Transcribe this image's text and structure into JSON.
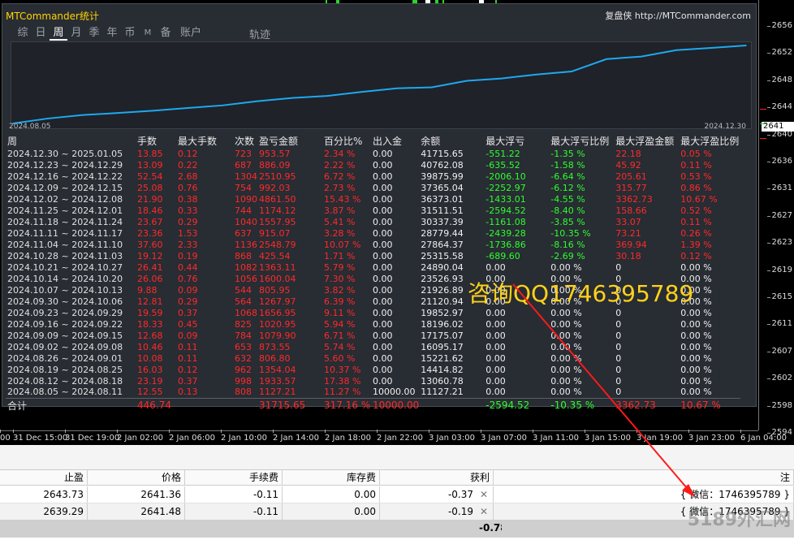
{
  "panel": {
    "title": "MTCommander统计",
    "site": "复盘侠 http://MTCommander.com",
    "tabs": [
      "综",
      "日",
      "周",
      "月",
      "季",
      "年",
      "币",
      "M",
      "备",
      "账户"
    ],
    "active_tab": "周",
    "track_label": "轨迹",
    "date_start": "2024.08.05",
    "date_end": "2024.12.30"
  },
  "table": {
    "headers": [
      "周",
      "手数",
      "最大手数",
      "次数",
      "盈亏金额",
      "百分比%",
      "出入金",
      "余额",
      "最大浮亏",
      "最大浮亏比例",
      "最大浮盈金额",
      "最大浮盈比例"
    ],
    "rows": [
      [
        "2024.12.30 ~ 2025.01.05",
        "13.85",
        "0.12",
        "723",
        "953.57",
        "2.34 %",
        "0.00",
        "41715.65",
        "-551.22",
        "-1.35 %",
        "22.18",
        "0.05 %"
      ],
      [
        "2024.12.23 ~ 2024.12.29",
        "13.09",
        "0.22",
        "687",
        "886.09",
        "2.22 %",
        "0.00",
        "40762.08",
        "-635.52",
        "-1.58 %",
        "45.92",
        "0.11 %"
      ],
      [
        "2024.12.16 ~ 2024.12.22",
        "52.54",
        "2.68",
        "1304",
        "2510.95",
        "6.72 %",
        "0.00",
        "39875.99",
        "-2006.10",
        "-6.64 %",
        "205.61",
        "0.53 %"
      ],
      [
        "2024.12.09 ~ 2024.12.15",
        "25.08",
        "0.76",
        "754",
        "992.03",
        "2.73 %",
        "0.00",
        "37365.04",
        "-2252.97",
        "-6.12 %",
        "315.77",
        "0.86 %"
      ],
      [
        "2024.12.02 ~ 2024.12.08",
        "21.90",
        "0.38",
        "1090",
        "4861.50",
        "15.43 %",
        "0.00",
        "36373.01",
        "-1433.01",
        "-4.55 %",
        "3362.73",
        "10.67 %"
      ],
      [
        "2024.11.25 ~ 2024.12.01",
        "18.46",
        "0.33",
        "744",
        "1174.12",
        "3.87 %",
        "0.00",
        "31511.51",
        "-2594.52",
        "-8.40 %",
        "158.66",
        "0.52 %"
      ],
      [
        "2024.11.18 ~ 2024.11.24",
        "23.67",
        "0.29",
        "1040",
        "1557.95",
        "5.41 %",
        "0.00",
        "30337.39",
        "-1161.08",
        "-3.85 %",
        "33.07",
        "0.11 %"
      ],
      [
        "2024.11.11 ~ 2024.11.17",
        "23.36",
        "1.53",
        "637",
        "915.07",
        "3.28 %",
        "0.00",
        "28779.44",
        "-2439.28",
        "-10.35 %",
        "73.21",
        "0.26 %"
      ],
      [
        "2024.11.04 ~ 2024.11.10",
        "37.60",
        "2.33",
        "1136",
        "2548.79",
        "10.07 %",
        "0.00",
        "27864.37",
        "-1736.86",
        "-8.16 %",
        "369.94",
        "1.39 %"
      ],
      [
        "2024.10.28 ~ 2024.11.03",
        "19.12",
        "0.19",
        "868",
        "425.54",
        "1.71 %",
        "0.00",
        "25315.58",
        "-689.60",
        "-2.69 %",
        "30.18",
        "0.12 %"
      ],
      [
        "2024.10.21 ~ 2024.10.27",
        "26.41",
        "0.44",
        "1082",
        "1363.11",
        "5.79 %",
        "0.00",
        "24890.04",
        "0.00",
        "0.00 %",
        "0",
        "0.00 %"
      ],
      [
        "2024.10.14 ~ 2024.10.20",
        "26.06",
        "0.76",
        "1056",
        "1600.04",
        "7.30 %",
        "0.00",
        "23526.93",
        "0.00",
        "0.00 %",
        "0",
        "0.00 %"
      ],
      [
        "2024.10.07 ~ 2024.10.13",
        "9.88",
        "0.09",
        "544",
        "805.95",
        "3.82 %",
        "0.00",
        "21926.89",
        "0.00",
        "0.00 %",
        "0",
        "0.00 %"
      ],
      [
        "2024.09.30 ~ 2024.10.06",
        "12.81",
        "0.29",
        "564",
        "1267.97",
        "6.39 %",
        "0.00",
        "21120.94",
        "0.00",
        "0.00 %",
        "0",
        "0.00 %"
      ],
      [
        "2024.09.23 ~ 2024.09.29",
        "19.59",
        "0.37",
        "1068",
        "1656.95",
        "9.11 %",
        "0.00",
        "19852.97",
        "0.00",
        "0.00 %",
        "0",
        "0.00 %"
      ],
      [
        "2024.09.16 ~ 2024.09.22",
        "18.33",
        "0.45",
        "825",
        "1020.95",
        "5.94 %",
        "0.00",
        "18196.02",
        "0.00",
        "0.00 %",
        "0",
        "0.00 %"
      ],
      [
        "2024.09.09 ~ 2024.09.15",
        "12.68",
        "0.09",
        "784",
        "1079.90",
        "6.71 %",
        "0.00",
        "17175.07",
        "0.00",
        "0.00 %",
        "0",
        "0.00 %"
      ],
      [
        "2024.09.02 ~ 2024.09.08",
        "10.46",
        "0.11",
        "653",
        "873.55",
        "5.74 %",
        "0.00",
        "16095.17",
        "0.00",
        "0.00 %",
        "0",
        "0.00 %"
      ],
      [
        "2024.08.26 ~ 2024.09.01",
        "10.08",
        "0.11",
        "632",
        "806.80",
        "5.60 %",
        "0.00",
        "15221.62",
        "0.00",
        "0.00 %",
        "0",
        "0.00 %"
      ],
      [
        "2024.08.19 ~ 2024.08.25",
        "16.03",
        "0.12",
        "962",
        "1354.04",
        "10.37 %",
        "0.00",
        "14414.82",
        "0.00",
        "0.00 %",
        "0",
        "0.00 %"
      ],
      [
        "2024.08.12 ~ 2024.08.18",
        "23.19",
        "0.37",
        "998",
        "1933.57",
        "17.38 %",
        "0.00",
        "13060.78",
        "0.00",
        "0.00 %",
        "0",
        "0.00 %"
      ],
      [
        "2024.08.05 ~ 2024.08.11",
        "12.55",
        "0.13",
        "808",
        "1127.21",
        "11.27 %",
        "10000.00",
        "11127.21",
        "0.00",
        "0.00 %",
        "0",
        "0.00 %"
      ]
    ],
    "total": [
      "合计",
      "446.74",
      "",
      "",
      "31715.65",
      "317.16 %",
      "10000.00",
      "",
      "-2594.52",
      "-10.35 %",
      "3362.73",
      "10.67 %"
    ]
  },
  "watermark_text": "咨询QQ1746395789",
  "price_axis": {
    "ticks": [
      "2656",
      "2652",
      "2648",
      "2644",
      "2640",
      "2636",
      "2631",
      "2627",
      "2623",
      "2619",
      "2615",
      "2611",
      "2607",
      "2602",
      "2598",
      "2594"
    ],
    "current_price": "2641"
  },
  "time_axis": [
    "00",
    "31 Dec 15:00",
    "31 Dec 19:00",
    "2 Jan 02:00",
    "2 Jan 06:00",
    "2 Jan 10:00",
    "2 Jan 14:00",
    "2 Jan 18:00",
    "2 Jan 22:00",
    "3 Jan 03:00",
    "3 Jan 07:00",
    "3 Jan 11:00",
    "3 Jan 15:00",
    "3 Jan 19:00",
    "3 Jan 23:00",
    "6 Jan 04:00"
  ],
  "orders": {
    "headers": [
      "止盈",
      "价格",
      "手续费",
      "库存费",
      "获利",
      "注"
    ],
    "rows": [
      [
        "2643.73",
        "2641.36",
        "-0.11",
        "0.00",
        "-0.37",
        "{ 微信：1746395789 }"
      ],
      [
        "2639.29",
        "2641.48",
        "-0.11",
        "0.00",
        "-0.19",
        "{ 微信：1746395789 }"
      ]
    ],
    "total_profit": "-0.78"
  },
  "site_watermark": "5189外汇网",
  "chart_data": {
    "type": "line",
    "x": [
      "2024.08.05",
      "2024.08.12",
      "2024.08.19",
      "2024.08.26",
      "2024.09.02",
      "2024.09.09",
      "2024.09.16",
      "2024.09.23",
      "2024.09.30",
      "2024.10.07",
      "2024.10.14",
      "2024.10.21",
      "2024.10.28",
      "2024.11.04",
      "2024.11.11",
      "2024.11.18",
      "2024.11.25",
      "2024.12.02",
      "2024.12.09",
      "2024.12.16",
      "2024.12.23",
      "2024.12.30"
    ],
    "values": [
      11127.21,
      13060.78,
      14414.82,
      15221.62,
      16095.17,
      17175.07,
      18196.02,
      19852.97,
      21120.94,
      21926.89,
      23526.93,
      24890.04,
      25315.58,
      27864.37,
      28779.44,
      30337.39,
      31511.51,
      36373.01,
      37365.04,
      39875.99,
      40762.08,
      41715.65
    ],
    "color": "#1ea8f0"
  }
}
